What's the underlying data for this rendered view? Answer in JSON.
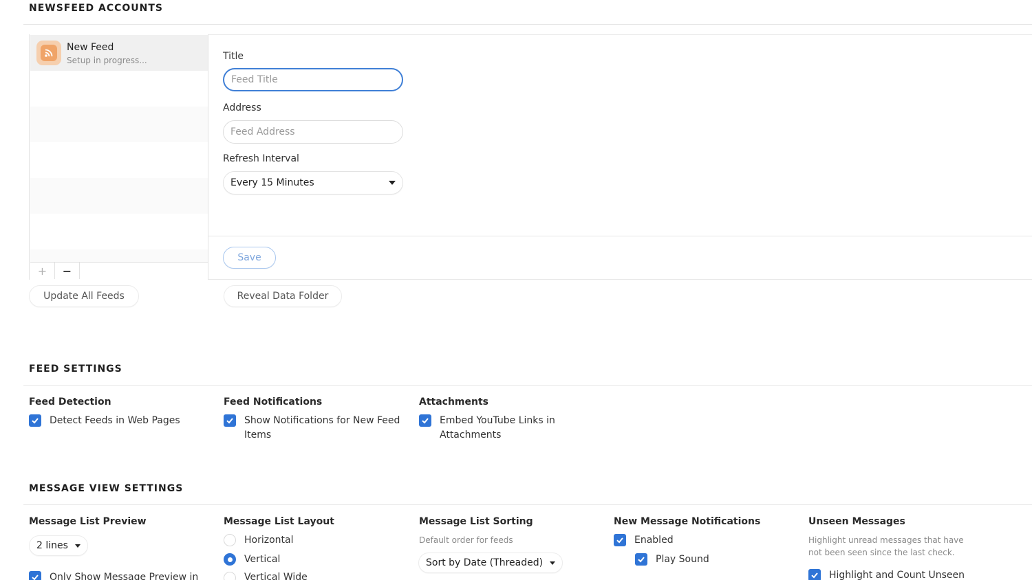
{
  "newsfeed_accounts": {
    "section_title": "NEWSFEED ACCOUNTS",
    "feed_list": {
      "items": [
        {
          "name": "New Feed",
          "status": "Setup in progress..."
        }
      ],
      "add_label": "+",
      "remove_label": "−"
    },
    "form": {
      "title_label": "Title",
      "title_placeholder": "Feed Title",
      "title_value": "",
      "address_label": "Address",
      "address_placeholder": "Feed Address",
      "address_value": "",
      "refresh_label": "Refresh Interval",
      "refresh_value": "Every 15 Minutes",
      "save_label": "Save"
    },
    "update_all_label": "Update All Feeds",
    "reveal_folder_label": "Reveal Data Folder"
  },
  "feed_settings": {
    "section_title": "FEED SETTINGS",
    "groups": [
      {
        "title": "Feed Detection",
        "checkbox_label": "Detect Feeds in Web Pages",
        "checked": true
      },
      {
        "title": "Feed Notifications",
        "checkbox_label": "Show Notifications for New Feed Items",
        "checked": true
      },
      {
        "title": "Attachments",
        "checkbox_label": "Embed YouTube Links in Attachments",
        "checked": true
      }
    ]
  },
  "message_view_settings": {
    "section_title": "MESSAGE VIEW SETTINGS",
    "preview": {
      "title": "Message List Preview",
      "value": "2 lines",
      "only_show_label": "Only Show Message Preview in"
    },
    "layout": {
      "title": "Message List Layout",
      "options": [
        "Horizontal",
        "Vertical",
        "Vertical Wide"
      ],
      "selected": "Vertical"
    },
    "sorting": {
      "title": "Message List Sorting",
      "subtitle": "Default order for feeds",
      "value": "Sort by Date (Threaded)"
    },
    "notifications": {
      "title": "New Message Notifications",
      "enabled_label": "Enabled",
      "play_sound_label": "Play Sound"
    },
    "unseen": {
      "title": "Unseen Messages",
      "subtitle": "Highlight unread messages that have not been seen since the last check.",
      "highlight_label": "Highlight and Count Unseen"
    }
  },
  "colors": {
    "accent": "#2f74d6",
    "focus_ring": "#3f7fd6",
    "feed_icon": "#f0a468"
  },
  "icons": {
    "feed": "rss-icon",
    "checkbox": "checkmark-icon",
    "dropdown": "caret-down-icon"
  }
}
